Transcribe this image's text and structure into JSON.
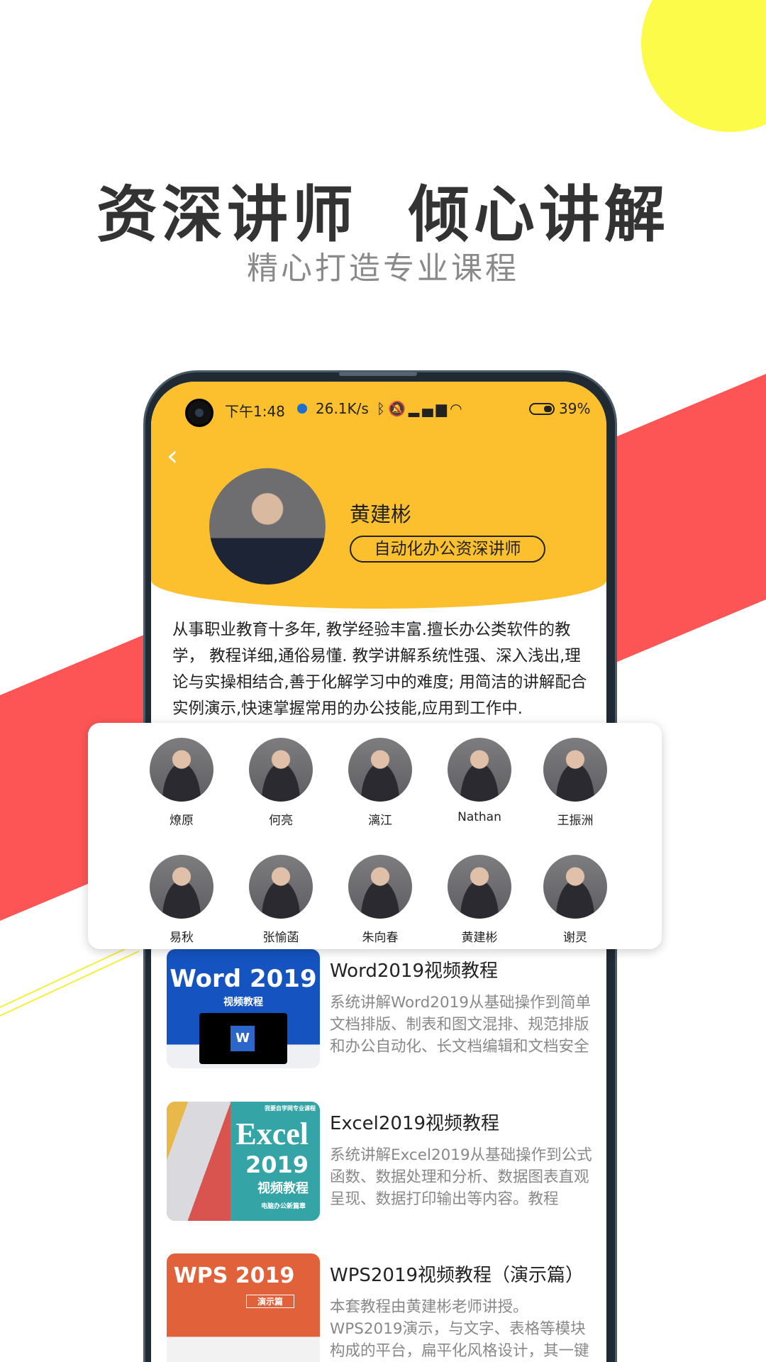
{
  "colors": {
    "accent_yellow": "#fcc02f",
    "band_red": "#fd5555",
    "sun_yellow": "#fcfb4a"
  },
  "hero": {
    "title": "资深讲师  倾心讲解",
    "subtitle": "精心打造专业课程"
  },
  "status_bar": {
    "time": "下午1:48",
    "speed": "26.1K/s",
    "battery": "39%",
    "icons": [
      "bluetooth-icon",
      "mute-icon",
      "signal-icon",
      "wifi-icon",
      "battery-icon"
    ]
  },
  "teacher": {
    "name": "黄建彬",
    "tag": "自动化办公资深讲师",
    "description": "从事职业教育十多年, 教学经验丰富.擅长办公类软件的教学， 教程详细,通俗易懂. 教学讲解系统性强、深入浅出,理论与实操相结合,善于化解学习中的难度; 用简洁的讲解配合实例演示,快速掌握常用的办公技能,应用到工作中."
  },
  "teachers": [
    "燎原",
    "何亮",
    "漓江",
    "Nathan",
    "王振洲",
    "易秋",
    "张愉菡",
    "朱向春",
    "黄建彬",
    "谢灵"
  ],
  "courses": [
    {
      "title": "Word2019视频教程",
      "desc": "系统讲解Word2019从基础操作到简单文档排版、制表和图文混排、规范排版和办公自动化、长文档编辑和文档安全",
      "thumb_title": "Word 2019",
      "thumb_sub": "视频教程"
    },
    {
      "title": "Excel2019视频教程",
      "desc": "系统讲解Excel2019从基础操作到公式函数、数据处理和分析、数据图表直观呈现、数据打印输出等内容。教程",
      "thumb_title": "Excel",
      "thumb_year": "2019",
      "thumb_sub": "视频教程",
      "thumb_top": "我要自学网专业课程",
      "thumb_bottom": "电脑办公新篇章"
    },
    {
      "title": "WPS2019视频教程（演示篇）",
      "desc": "本套教程由黄建彬老师讲授。WPS2019演示，与文字、表格等模块构成的平台，扁平化风格设计，其一键",
      "thumb_title": "WPS 2019",
      "thumb_sub": "演示篇"
    }
  ]
}
